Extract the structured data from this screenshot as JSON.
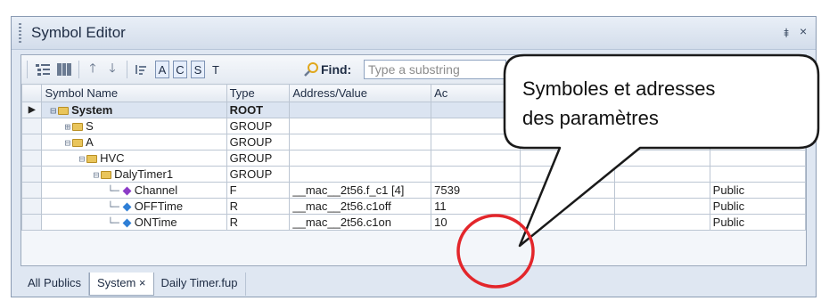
{
  "window": {
    "title": "Symbol Editor",
    "pin_glyph": "⯒",
    "close_glyph": "×"
  },
  "toolbar": {
    "letters": [
      "A",
      "C",
      "S",
      "T"
    ],
    "find_label": "Find:",
    "find_placeholder": "Type a substring"
  },
  "grid": {
    "columns": [
      "Symbol Name",
      "Type",
      "Address/Value",
      "Ac"
    ],
    "rows": [
      {
        "name": "System",
        "type": "ROOT",
        "address": "",
        "actual": "",
        "access": "",
        "level": 0,
        "icon": "folder",
        "expanded": true,
        "current": true
      },
      {
        "name": "S",
        "type": "GROUP",
        "address": "",
        "actual": "",
        "access": "",
        "level": 1,
        "icon": "folder",
        "expanded": false
      },
      {
        "name": "A",
        "type": "GROUP",
        "address": "",
        "actual": "",
        "access": "",
        "level": 1,
        "icon": "folder",
        "expanded": true
      },
      {
        "name": "HVC",
        "type": "GROUP",
        "address": "",
        "actual": "",
        "access": "",
        "level": 2,
        "icon": "folder",
        "expanded": true
      },
      {
        "name": "DalyTimer1",
        "type": "GROUP",
        "address": "",
        "actual": "",
        "access": "",
        "level": 3,
        "icon": "folder",
        "expanded": true
      },
      {
        "name": "Channel",
        "type": "F",
        "address": "__mac__2t56.f_c1 [4]",
        "actual": "7539",
        "access": "Public",
        "level": 4,
        "icon": "diamond-purple"
      },
      {
        "name": "OFFTime",
        "type": "R",
        "address": "__mac__2t56.c1off",
        "actual": "11",
        "access": "Public",
        "level": 4,
        "icon": "diamond-blue"
      },
      {
        "name": "ONTime",
        "type": "R",
        "address": "__mac__2t56.c1on",
        "actual": "10",
        "access": "Public",
        "level": 4,
        "icon": "diamond-blue"
      }
    ]
  },
  "tabs": [
    {
      "label": "All Publics",
      "active": false
    },
    {
      "label": "System ×",
      "active": true
    },
    {
      "label": "Daily Timer.fup",
      "active": false
    }
  ],
  "callout": {
    "line1": "Symboles et adresses",
    "line2": "des paramètres",
    "highlight_color": "#e3262b"
  },
  "colors": {
    "accent": "#7d93b5",
    "folder": "#e9c55b",
    "diamond_purple": "#8c3cc7",
    "diamond_blue": "#2f7fd6"
  }
}
